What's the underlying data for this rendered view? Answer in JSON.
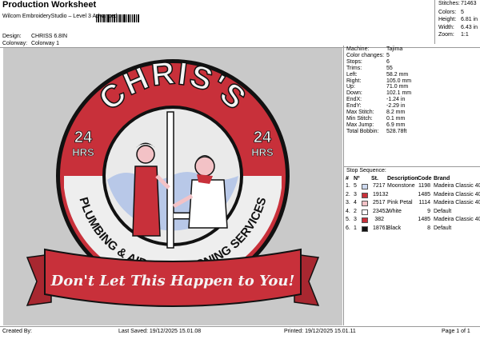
{
  "header": {
    "title": "Production Worksheet",
    "subtitle": "Wilcom EmbroideryStudio – Level 3 Advanced",
    "design_label": "Design:",
    "design_value": "CHRISS 6.8IN",
    "colorway_label": "Colorway:",
    "colorway_value": "Colorway 1"
  },
  "summary": [
    {
      "label": "Stitches:",
      "value": "71463"
    },
    {
      "label": "Colors:",
      "value": "5"
    },
    {
      "label": "Height:",
      "value": "6.81 in"
    },
    {
      "label": "Width:",
      "value": "6.43 in"
    },
    {
      "label": "Zoom:",
      "value": "1:1"
    }
  ],
  "machine_info": [
    {
      "label": "Machine:",
      "value": "Tajima"
    },
    {
      "label": "Color changes:",
      "value": "5"
    },
    {
      "label": "Stops:",
      "value": "6"
    },
    {
      "label": "Trims:",
      "value": "55"
    },
    {
      "label": "Left:",
      "value": "58.2 mm"
    },
    {
      "label": "Right:",
      "value": "105.0 mm"
    },
    {
      "label": "Up:",
      "value": "71.0 mm"
    },
    {
      "label": "Down:",
      "value": "102.1 mm"
    },
    {
      "label": "EndX:",
      "value": "-1.24 in"
    },
    {
      "label": "EndY:",
      "value": "-2.29 in"
    },
    {
      "label": "Max Stitch:",
      "value": "8.2 mm"
    },
    {
      "label": "Min Stitch:",
      "value": "0.1 mm"
    },
    {
      "label": "Max Jump:",
      "value": "6.9 mm"
    },
    {
      "label": "Total Bobbin:",
      "value": "528.78ft"
    }
  ],
  "stop_sequence": {
    "title": "Stop Sequence:",
    "headers": {
      "num": "#",
      "n": "Nº",
      "st": "St.",
      "desc": "Description",
      "code": "Code",
      "brand": "Brand"
    },
    "rows": [
      {
        "num": "1.",
        "n": "5",
        "st": "7217",
        "desc": "Moonstone",
        "code": "1198",
        "brand": "Madeira Classic 40",
        "color": "#cdd9ef"
      },
      {
        "num": "2.",
        "n": "3",
        "st": "19132",
        "desc": "",
        "code": "1485",
        "brand": "Madeira Classic 40",
        "color": "#c8303a"
      },
      {
        "num": "3.",
        "n": "4",
        "st": "2517",
        "desc": "Pink Petal",
        "code": "1114",
        "brand": "Madeira Classic 40",
        "color": "#f3c2c6"
      },
      {
        "num": "4.",
        "n": "2",
        "st": "23452",
        "desc": "White",
        "code": "9",
        "brand": "Default",
        "color": "#ffffff"
      },
      {
        "num": "5.",
        "n": "3",
        "st": "382",
        "desc": "",
        "code": "1485",
        "brand": "Madeira Classic 40",
        "color": "#c8303a"
      },
      {
        "num": "6.",
        "n": "1",
        "st": "18761",
        "desc": "Black",
        "code": "8",
        "brand": "Default",
        "color": "#111111"
      }
    ]
  },
  "design": {
    "top_text": "CHRIS'S",
    "left_hrs_num": "24",
    "left_hrs": "HRS",
    "right_hrs_num": "24",
    "right_hrs": "HRS",
    "arc_text": "PLUMBING & AIR CONDITIONING SERVICES",
    "ribbon_text": "Don't Let This Happen to You!",
    "colors": {
      "red": "#c8303a",
      "white": "#f4f4f4",
      "black": "#111111",
      "water": "#b8c8e8",
      "skin": "#f3c2c6"
    }
  },
  "footer": {
    "created": "Created By:",
    "saved": "Last Saved: 19/12/2025 15.01.08",
    "printed": "Printed: 19/12/2025 15.01.11",
    "page": "Page 1 of 1"
  }
}
